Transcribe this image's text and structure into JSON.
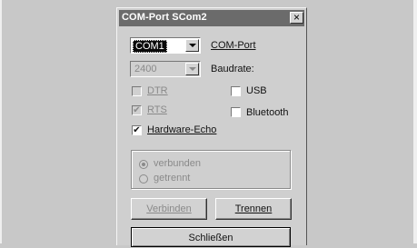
{
  "window": {
    "title": "COM-Port SCom2",
    "close_symbol": "×"
  },
  "port": {
    "selected": "COM1",
    "label": "COM-Port"
  },
  "baud": {
    "selected": "2400",
    "label": "Baudrate:"
  },
  "options": {
    "dtr": {
      "label": "DTR",
      "checked": false,
      "enabled": false
    },
    "rts": {
      "label": "RTS",
      "checked": true,
      "enabled": false
    },
    "usb": {
      "label": "USB",
      "checked": false
    },
    "bluetooth": {
      "label": "Bluetooth",
      "checked": false
    },
    "hardware_echo": {
      "label": "Hardware-Echo",
      "checked": true
    },
    "check_mark": "✔"
  },
  "status": {
    "connected_label": "verbunden",
    "disconnected_label": "getrennt",
    "selected": "verbunden"
  },
  "buttons": {
    "connect": "Verbinden",
    "disconnect": "Trennen",
    "close": "Schließen"
  }
}
